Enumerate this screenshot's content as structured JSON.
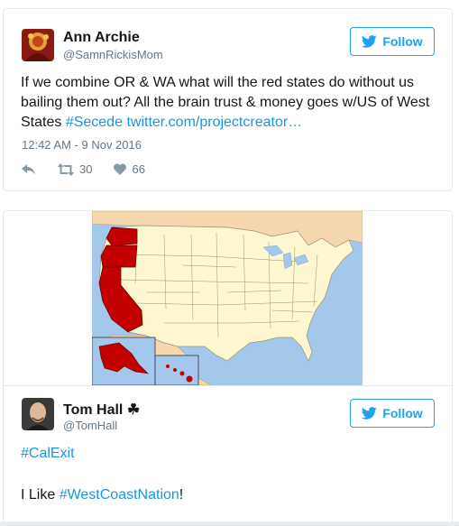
{
  "tweet1": {
    "name": "Ann Archie",
    "handle": "@SamnRickisMom",
    "follow_label": "Follow",
    "text_plain": "If we combine OR & WA what will the red states do without us bailing them out? All the brain trust & money goes w/US of West States ",
    "hashtag": "#Secede",
    "link": "twitter.com/projectcreator…",
    "timestamp": "12:42 AM - 9 Nov 2016",
    "retweets": "30",
    "likes": "66"
  },
  "tweet2": {
    "name": "Tom Hall ☘",
    "handle": "@TomHall",
    "follow_label": "Follow",
    "hashtag1": "#CalExit",
    "line2_prefix": "I Like ",
    "hashtag2": "#WestCoastNation",
    "line2_suffix": "!"
  },
  "colors": {
    "accent": "#1da1f2",
    "link": "#1b95e0",
    "ocean": "#a4c8ec",
    "land": "#fdf7cf",
    "highlight": "#c30000",
    "neighbor": "#f5d8ad"
  }
}
